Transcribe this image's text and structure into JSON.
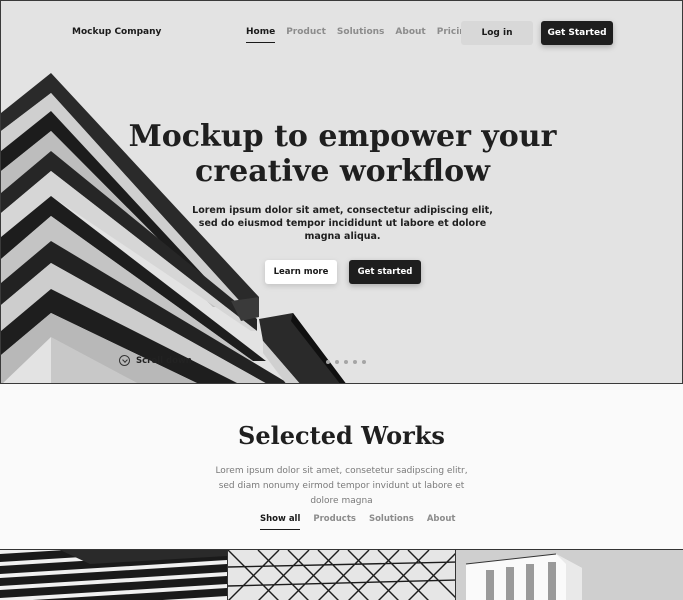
{
  "header": {
    "brand": "Mockup Company",
    "nav": [
      {
        "label": "Home",
        "active": true
      },
      {
        "label": "Product",
        "active": false
      },
      {
        "label": "Solutions",
        "active": false
      },
      {
        "label": "About",
        "active": false
      },
      {
        "label": "Pricing",
        "active": false
      }
    ],
    "login_label": "Log in",
    "get_started_label": "Get Started"
  },
  "hero": {
    "title_line1": "Mockup to empower your",
    "title_line2": "creative workflow",
    "subtitle": "Lorem ipsum dolor sit amet, consectetur adipiscing elit, sed do eiusmod tempor incididunt ut labore et dolore magna aliqua.",
    "learn_more_label": "Learn more",
    "get_started_label": "Get started",
    "scroll_label": "Scroll down",
    "slides_count": 6,
    "active_slide": 1
  },
  "works": {
    "title": "Selected Works",
    "subtitle": "Lorem ipsum dolor sit amet, consetetur sadipscing elitr, sed diam nonumy eirmod tempor invidunt ut labore et dolore magna",
    "filters": [
      {
        "label": "Show all",
        "active": true
      },
      {
        "label": "Products",
        "active": false
      },
      {
        "label": "Solutions",
        "active": false
      },
      {
        "label": "About",
        "active": false
      }
    ]
  },
  "colors": {
    "dark": "#1e1e1e",
    "muted": "#8c8c8c",
    "hero_bg": "#e4e4e4"
  }
}
